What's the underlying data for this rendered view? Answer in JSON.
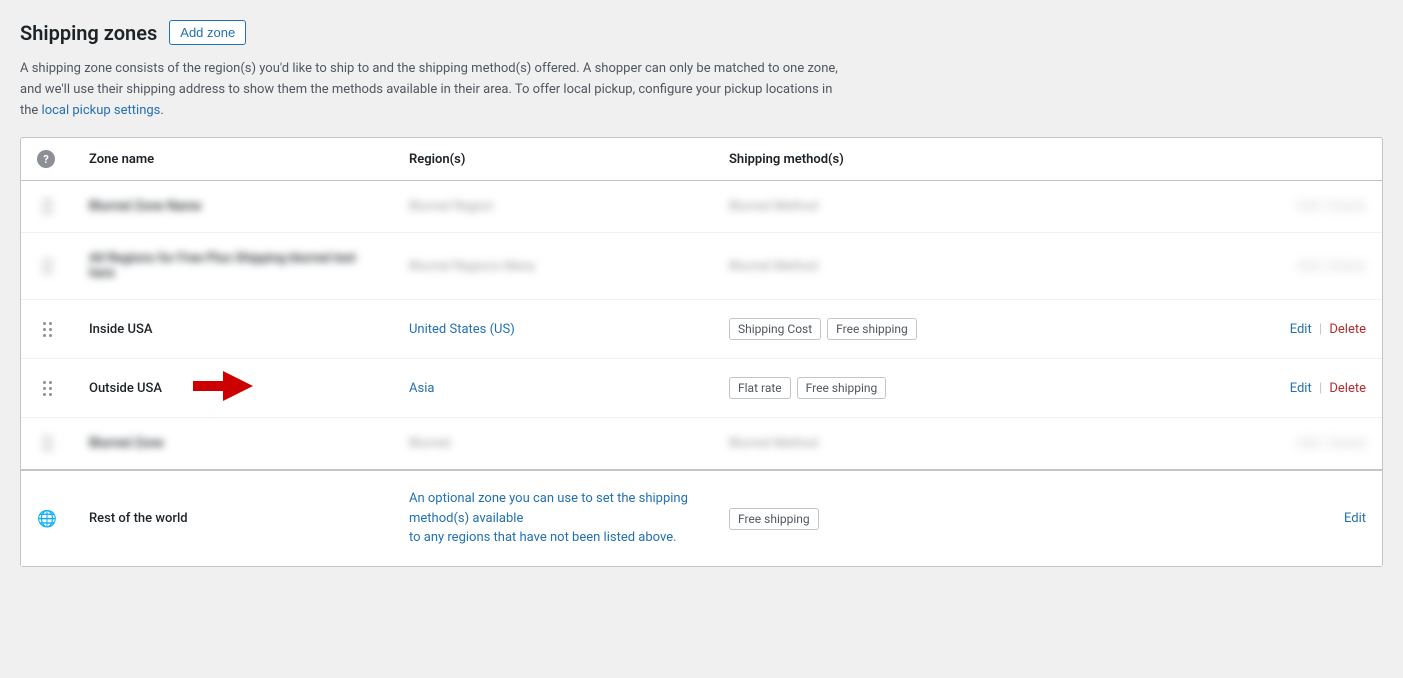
{
  "page": {
    "title": "Shipping zones",
    "add_zone_label": "Add zone",
    "description": "A shipping zone consists of the region(s) you'd like to ship to and the shipping method(s) offered. A shopper can only be matched to one zone, and we'll use their shipping address to show them the methods available in their area. To offer local pickup, configure your pickup locations in the",
    "description_link_text": "local pickup settings",
    "description_end": "."
  },
  "table": {
    "headers": {
      "help": "?",
      "zone_name": "Zone name",
      "regions": "Region(s)",
      "shipping_methods": "Shipping method(s)"
    },
    "rows": [
      {
        "id": "row-blurred-1",
        "blurred": true,
        "zone_name": "Blurred Zone 1",
        "region": "Blurred Region",
        "methods": [
          "Blurred"
        ],
        "actions_blurred": true
      },
      {
        "id": "row-blurred-2",
        "blurred": true,
        "zone_name": "All Regions for Free Plus Shipping (blurred)",
        "region": "Blurred Regions",
        "methods": [
          "Blurred"
        ],
        "actions_blurred": true
      },
      {
        "id": "row-inside-usa",
        "blurred": false,
        "zone_name": "Inside USA",
        "region": "United States (US)",
        "region_is_link": true,
        "methods": [
          "Shipping Cost",
          "Free shipping"
        ],
        "edit_label": "Edit",
        "delete_label": "Delete"
      },
      {
        "id": "row-outside-usa",
        "blurred": false,
        "zone_name": "Outside USA",
        "region": "Asia",
        "region_is_link": true,
        "methods": [
          "Flat rate",
          "Free shipping"
        ],
        "has_arrow": true,
        "edit_label": "Edit",
        "delete_label": "Delete"
      },
      {
        "id": "row-blurred-3",
        "blurred": true,
        "zone_name": "Blurred Zone 3",
        "region": "Blurred",
        "methods": [
          "Blurred"
        ],
        "actions_blurred": true
      }
    ],
    "rest_of_world": {
      "zone_name": "Rest of the world",
      "description_part1": "An optional zone you can use to set the shipping method(s) available",
      "description_part2": "to any regions that have not been listed above.",
      "method": "Free shipping",
      "edit_label": "Edit"
    }
  },
  "colors": {
    "accent": "#2271b1",
    "delete": "#b32d2e",
    "badge_border": "#c3c4c7",
    "blurred": "#ccc"
  }
}
